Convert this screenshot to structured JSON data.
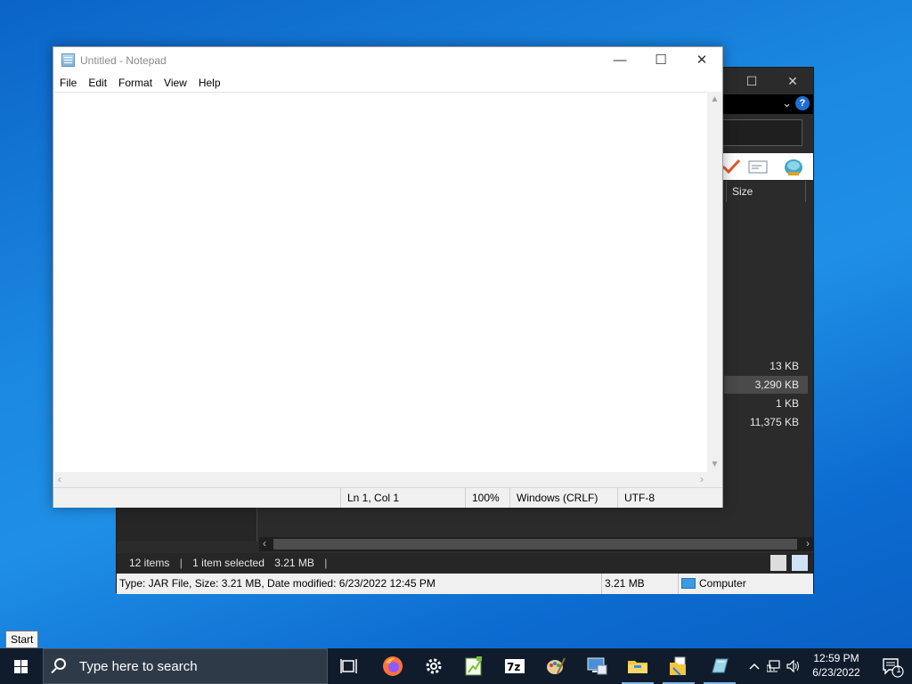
{
  "notepad": {
    "title": "Untitled - Notepad",
    "controls": {
      "minimize": "—",
      "maximize": "☐",
      "close": "✕"
    },
    "menu": [
      "File",
      "Edit",
      "Format",
      "View",
      "Help"
    ],
    "content": "",
    "status": {
      "position": "Ln 1, Col 1",
      "zoom": "100%",
      "line_ending": "Windows (CRLF)",
      "encoding": "UTF-8"
    }
  },
  "file_manager": {
    "controls": {
      "maximize": "☐",
      "close": "✕"
    },
    "help_label": "?",
    "column_size": "Size",
    "sizes": [
      "13 KB",
      "3,290 KB",
      "1 KB",
      "11,375 KB"
    ],
    "selected_index": 1,
    "status": {
      "items": "12 items",
      "selected": "1 item selected",
      "selected_size": "3.21 MB"
    },
    "info_bar": {
      "details": "Type: JAR File, Size: 3.21 MB, Date modified: 6/23/2022 12:45 PM",
      "size": "3.21 MB",
      "location": "Computer"
    }
  },
  "tooltip": {
    "text": "Start"
  },
  "taskbar": {
    "search_placeholder": "Type here to search",
    "apps": [
      {
        "name": "task-view-icon",
        "color": "#ffffff"
      },
      {
        "name": "firefox-icon",
        "color": "#ff7139"
      },
      {
        "name": "settings-icon",
        "color": "#ffffff"
      },
      {
        "name": "notepad-plus-icon",
        "color": "#7cbf3a"
      },
      {
        "name": "7zip-icon",
        "color": "#ffffff"
      },
      {
        "name": "paint-icon",
        "color": "#d8b56a"
      },
      {
        "name": "remote-desktop-icon",
        "color": "#4a8fd8"
      },
      {
        "name": "file-explorer-icon",
        "color": "#f4c542"
      },
      {
        "name": "folder-document-icon",
        "color": "#f4c542"
      },
      {
        "name": "app-icon",
        "color": "#9ed4e8"
      }
    ],
    "clock": {
      "time": "12:59 PM",
      "date": "6/23/2022"
    },
    "notification_count": "1"
  }
}
